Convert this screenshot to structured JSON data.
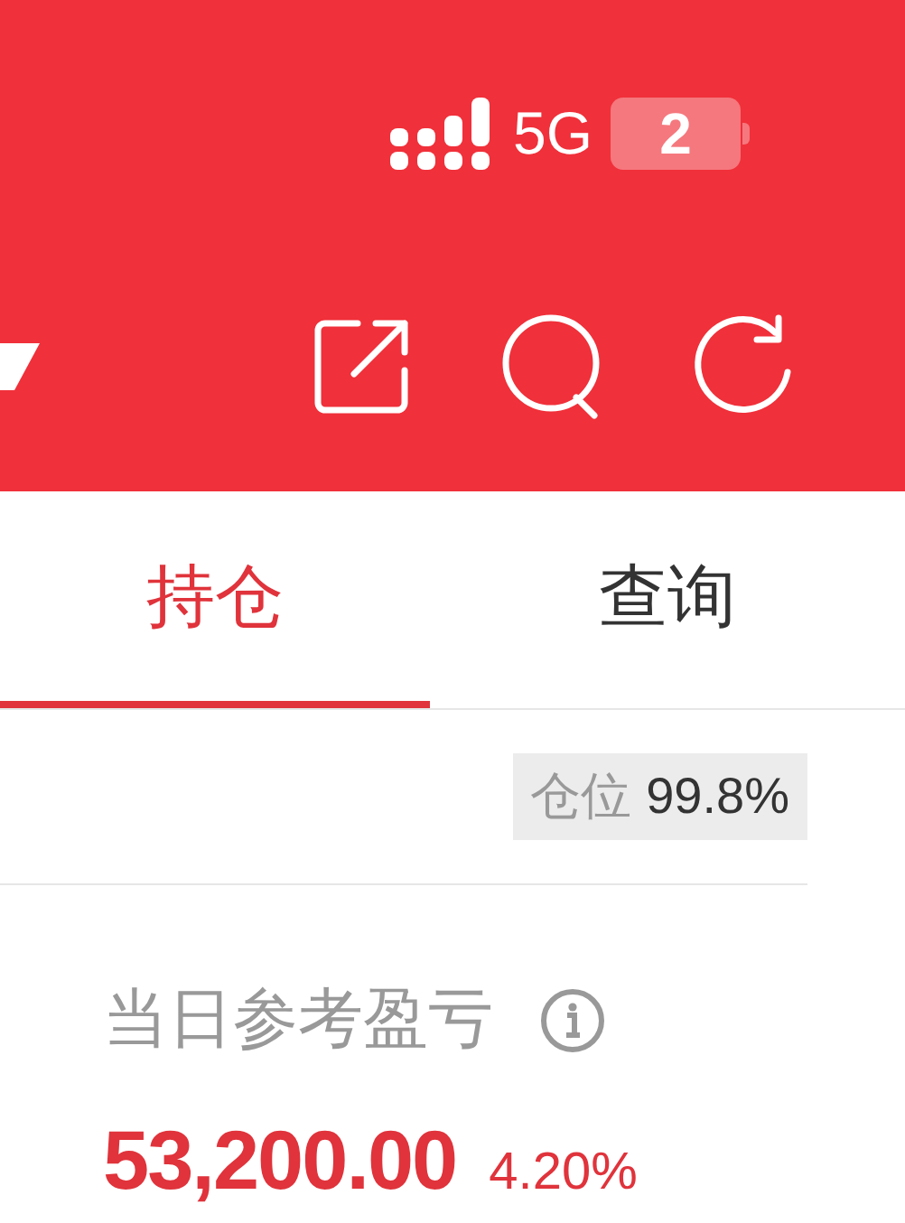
{
  "status_bar": {
    "network": "5G",
    "battery": "2"
  },
  "tabs": [
    {
      "label": "持仓",
      "selected": true
    },
    {
      "label": "查询",
      "selected": false
    }
  ],
  "position": {
    "label": "仓位",
    "value": "99.8%"
  },
  "pnl": {
    "label": "当日参考盈亏",
    "amount": "53,200.00",
    "percent": "4.20%"
  }
}
